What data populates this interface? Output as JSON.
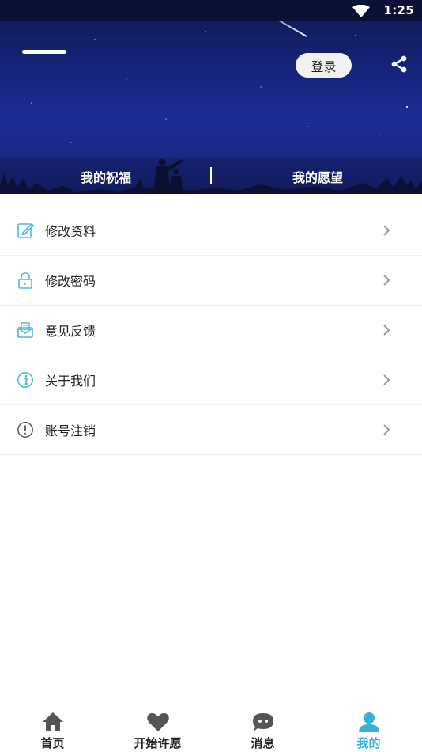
{
  "status_bar": {
    "time": "1:25"
  },
  "header": {
    "login_label": "登录",
    "tabs": [
      {
        "label": "我的祝福"
      },
      {
        "label": "我的愿望"
      }
    ]
  },
  "menu": {
    "items": [
      {
        "label": "修改资料",
        "icon": "edit-icon"
      },
      {
        "label": "修改密码",
        "icon": "lock-icon"
      },
      {
        "label": "意见反馈",
        "icon": "mail-icon"
      },
      {
        "label": "关于我们",
        "icon": "info-icon"
      },
      {
        "label": "账号注销",
        "icon": "alert-icon"
      }
    ]
  },
  "bottom_nav": {
    "items": [
      {
        "label": "首页",
        "icon": "home-icon"
      },
      {
        "label": "开始许愿",
        "icon": "heart-icon"
      },
      {
        "label": "消息",
        "icon": "chat-icon"
      },
      {
        "label": "我的",
        "icon": "user-icon",
        "active": true
      }
    ]
  },
  "colors": {
    "accent": "#3ab0d8",
    "header_sky": "#1d2c96",
    "menu_icon": "#4db8dd"
  }
}
